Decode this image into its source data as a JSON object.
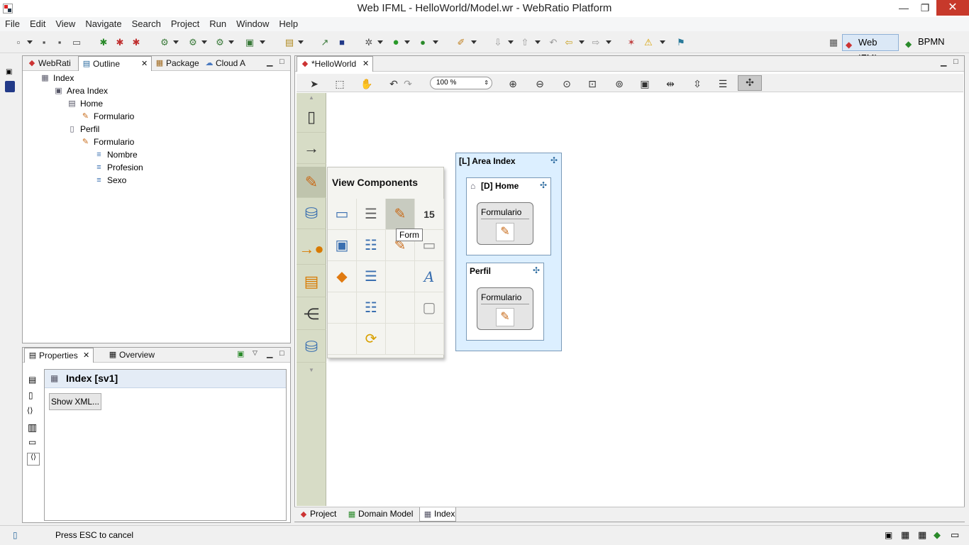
{
  "window": {
    "title": "Web IFML - HelloWorld/Model.wr - WebRatio Platform",
    "minimize": "—",
    "maximize": "❐",
    "close": "✕"
  },
  "menu": [
    "File",
    "Edit",
    "View",
    "Navigate",
    "Search",
    "Project",
    "Run",
    "Window",
    "Help"
  ],
  "perspectives": {
    "web_ifml": "Web IFML",
    "bpmn": "BPMN"
  },
  "left_panel": {
    "tabs": [
      "WebRati",
      "Outline",
      "Package",
      "Cloud A"
    ],
    "tree": [
      {
        "label": "Index",
        "icon": "site-view-icon",
        "glyph": "▦",
        "indent": 0
      },
      {
        "label": "Area Index",
        "icon": "area-icon",
        "glyph": "▣",
        "indent": 1
      },
      {
        "label": "Home",
        "icon": "home-page-icon",
        "glyph": "▤",
        "indent": 2
      },
      {
        "label": "Formulario",
        "icon": "form-icon",
        "glyph": "✎",
        "indent": 3
      },
      {
        "label": "Perfil",
        "icon": "page-icon",
        "glyph": "▯",
        "indent": 2
      },
      {
        "label": "Formulario",
        "icon": "form-icon",
        "glyph": "✎",
        "indent": 3
      },
      {
        "label": "Nombre",
        "icon": "field-icon",
        "glyph": "≡",
        "indent": 4
      },
      {
        "label": "Profesion",
        "icon": "field-icon",
        "glyph": "≡",
        "indent": 4
      },
      {
        "label": "Sexo",
        "icon": "field-icon",
        "glyph": "≡",
        "indent": 4
      }
    ]
  },
  "properties_panel": {
    "tabs": [
      "Properties",
      "Overview"
    ],
    "header": "Index [sv1]",
    "show_xml": "Show XML..."
  },
  "editor": {
    "tab": "*HelloWorld",
    "zoom": "100 %",
    "palette_popup_title": "View Components",
    "tooltip": "Form",
    "area": {
      "title": "[L] Area Index"
    },
    "home": {
      "title": "[D] Home",
      "unit": "Formulario"
    },
    "perfil": {
      "title": "Perfil",
      "unit": "Formulario"
    },
    "bottom_tabs": [
      "Project",
      "Domain Model",
      "Index"
    ]
  },
  "status": {
    "message": "Press ESC to cancel"
  }
}
